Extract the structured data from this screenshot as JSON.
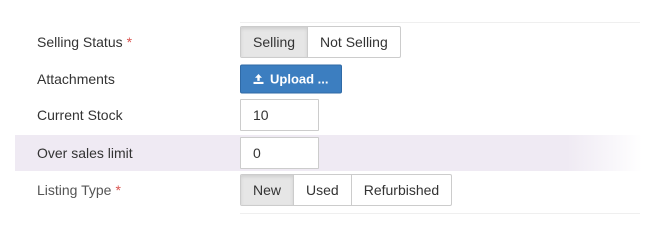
{
  "form": {
    "selling_status": {
      "label": "Selling Status",
      "required_mark": "*",
      "options": [
        "Selling",
        "Not Selling"
      ],
      "selected": "Selling"
    },
    "attachments": {
      "label": "Attachments",
      "upload_label": "Upload ..."
    },
    "current_stock": {
      "label": "Current Stock",
      "value": "10"
    },
    "over_sales_limit": {
      "label": "Over sales limit",
      "value": "0"
    },
    "listing_type": {
      "label": "Listing Type",
      "required_mark": "*",
      "options": [
        "New",
        "Used",
        "Refurbished"
      ],
      "selected": "New"
    }
  },
  "icons": {
    "upload": "upload-icon"
  },
  "colors": {
    "primary_button": "#3c7ec0",
    "required": "#d9534f",
    "row_highlight": "#efeaf3",
    "active_segment": "#e6e6e6"
  }
}
